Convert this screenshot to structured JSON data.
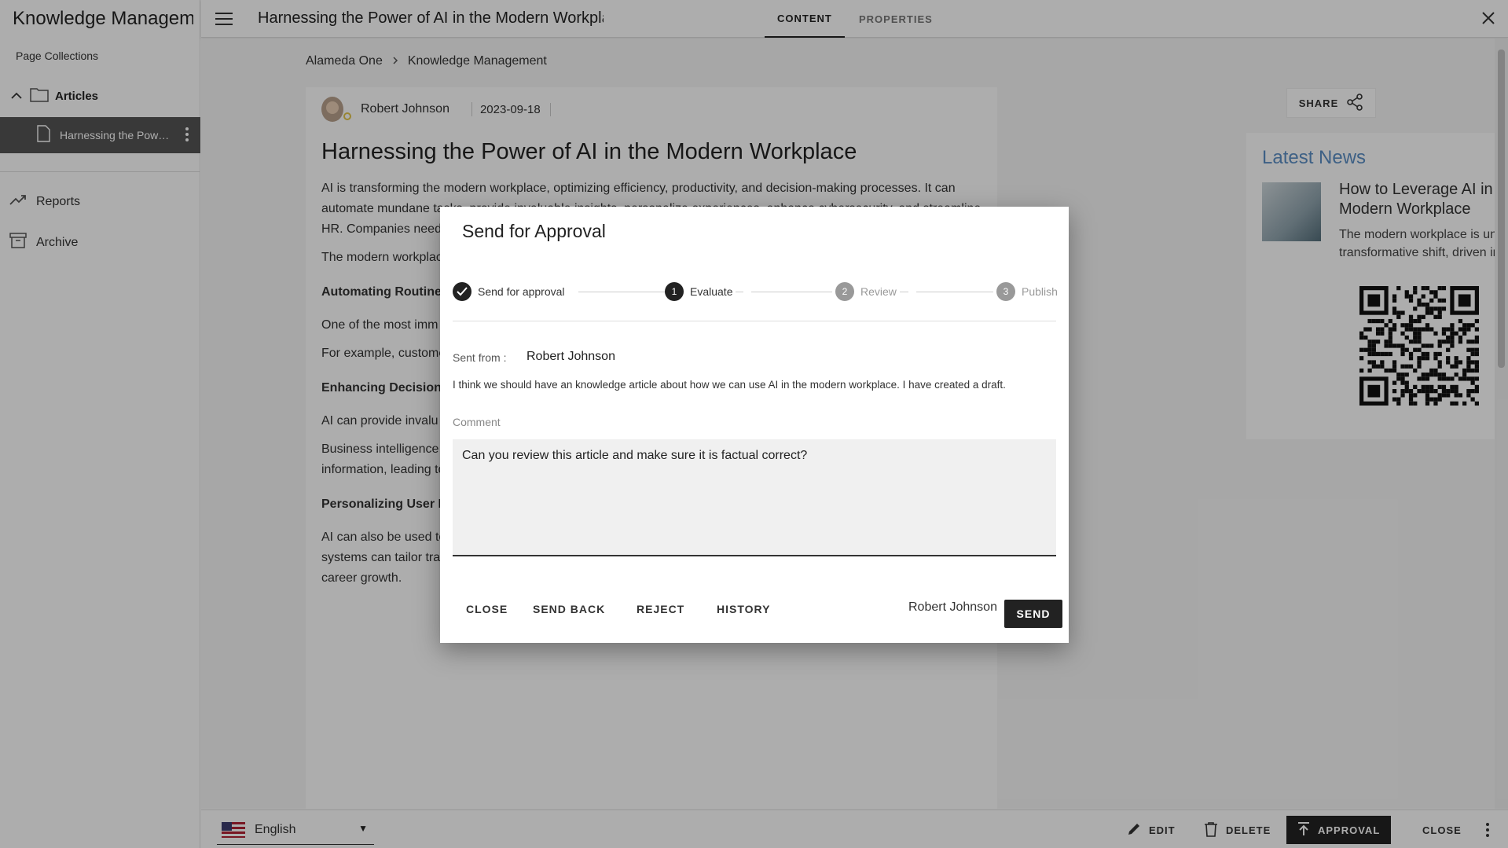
{
  "app": {
    "title": "Knowledge Management"
  },
  "sidebar": {
    "collections_label": "Page Collections",
    "folder": {
      "label": "Articles"
    },
    "selected_item": {
      "label": "Harnessing the Power of AI in the Modern Workplace"
    },
    "nav": [
      {
        "label": "Reports",
        "icon": "trend-icon"
      },
      {
        "label": "Archive",
        "icon": "archive-icon"
      }
    ]
  },
  "header": {
    "title": "Harnessing the Power of AI in the Modern Workplace",
    "tabs": [
      {
        "label": "CONTENT",
        "active": true
      },
      {
        "label": "PROPERTIES",
        "active": false
      }
    ]
  },
  "breadcrumb": [
    "Alameda One",
    "Knowledge Management"
  ],
  "article": {
    "author": "Robert Johnson",
    "date": "2023-09-18",
    "title": "Harnessing the Power of AI in the Modern Workplace",
    "p1": "AI is transforming the modern workplace, optimizing efficiency, productivity, and decision-making processes. It can automate mundane tasks, provide invaluable insights, personalize experiences, enhance cybersecurity, and streamline HR. Companies need",
    "p2": "The modern workplac these advancements, operate, enhancing e effectively use AI in t",
    "h1": "Automating Routine T",
    "p3": "One of the most imm repetitive tasks that c software. This frees u",
    "p4": "For example, custome scheduling, and finan optimize efficiency w",
    "h2": "Enhancing Decision-I",
    "p5": "AI can provide invalu amounts of data to id making approach can",
    "p6": "Business intelligence customer behavior, and market trends. This empowers decision-makers with actionable information, leading to more effective strategies and improved outcomes.",
    "h3": "Personalizing User Experiences",
    "p7": "AI can also be used to create personalized user experiences, both internally and externally. Internally, AI-driven systems can tailor training and development programs to individual employee needs, helping to enhance skillsets and career growth."
  },
  "share": {
    "label": "SHARE"
  },
  "news": {
    "heading": "Latest News",
    "item_title": "How to Leverage AI in the Modern Workplace",
    "item_text": "The modern workplace is undergoing a transformative shift, driven in large part b..."
  },
  "bottom": {
    "language": "English",
    "edit": "EDIT",
    "delete": "DELETE",
    "approval": "APPROVAL",
    "close": "CLOSE"
  },
  "dialog": {
    "title": "Send for Approval",
    "steps": [
      {
        "label": "Send for approval",
        "state": "done"
      },
      {
        "num": "1",
        "label": "Evaluate",
        "state": "active"
      },
      {
        "num": "2",
        "label": "Review",
        "state": "pending"
      },
      {
        "num": "3",
        "label": "Publish",
        "state": "pending"
      }
    ],
    "sent_from_label": "Sent from :",
    "sent_from_value": "Robert Johnson",
    "message": "I think we should have an knowledge article about how we can use AI in the modern workplace. I have created a draft.",
    "comment_label": "Comment",
    "comment_value": "Can you review this article and make sure it is factual correct?",
    "buttons": {
      "close": "CLOSE",
      "send_back": "SEND BACK",
      "reject": "REJECT",
      "history": "HISTORY",
      "send": "SEND"
    },
    "recipient": "Robert Johnson"
  }
}
